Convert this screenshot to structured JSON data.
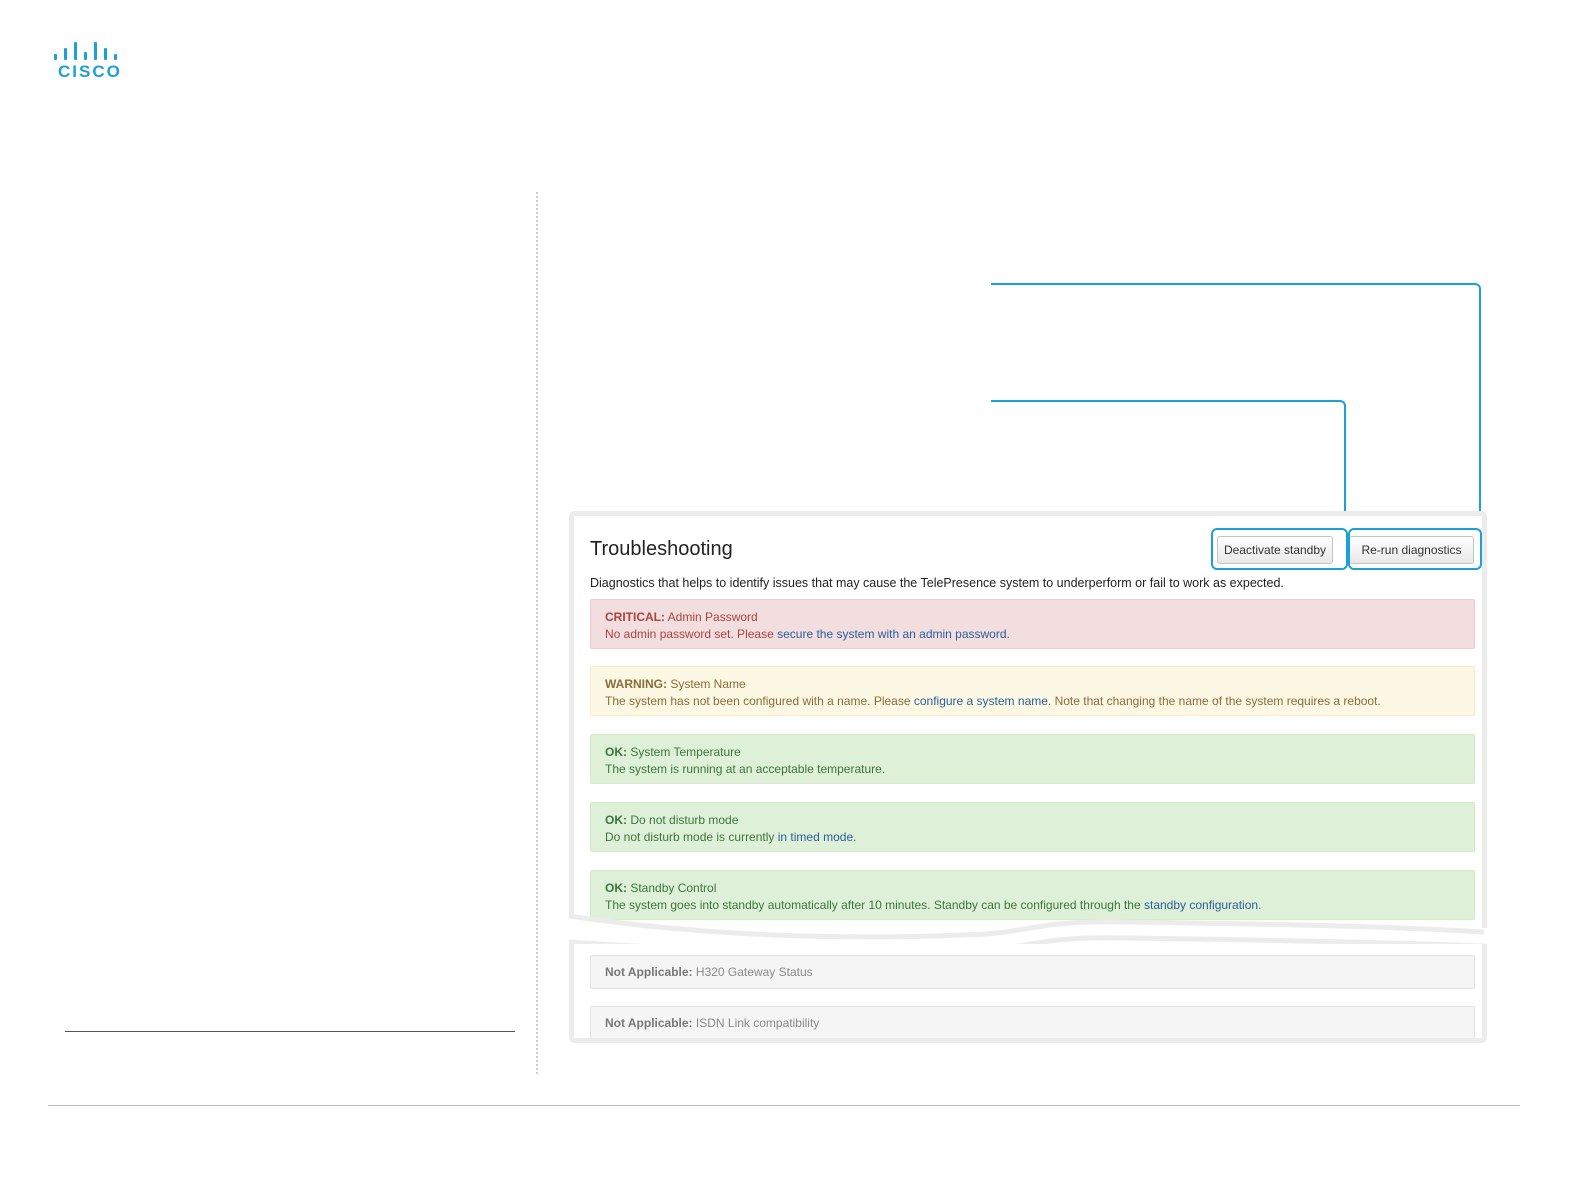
{
  "brand": {
    "logo_text": "CISCO",
    "accent": "#1ba0d7"
  },
  "panel": {
    "title": "Troubleshooting",
    "description": "Diagnostics that helps to identify issues that may cause the TelePresence system to underperform or fail to work as expected.",
    "buttons": {
      "deactivate_standby": "Deactivate standby",
      "rerun_diagnostics": "Re-run diagnostics"
    }
  },
  "diagnostics": [
    {
      "level": "CRITICAL:",
      "title": "Admin Password",
      "text_before": "No admin password set. Please ",
      "link": "secure the system with an admin password",
      "text_after": ".",
      "color": "#a94442"
    },
    {
      "level": "WARNING:",
      "title": "System Name",
      "text_before": "The system has not been configured with a name. Please ",
      "link": "configure a system name",
      "text_after": ". Note that changing the name of the system requires a reboot.",
      "color": "#8a6d3b"
    },
    {
      "level": "OK:",
      "title": "System Temperature",
      "text_before": "The system is running at an acceptable temperature.",
      "link": "",
      "text_after": "",
      "color": "#3c763d"
    },
    {
      "level": "OK:",
      "title": "Do not disturb mode",
      "text_before": "Do not disturb mode is currently ",
      "link": "in timed mode",
      "text_after": ".",
      "color": "#3c763d"
    },
    {
      "level": "OK:",
      "title": "Standby Control",
      "text_before": "The system goes into standby automatically after 10 minutes. Standby can be configured through the ",
      "link": "standby configuration",
      "text_after": ".",
      "color": "#3c763d"
    }
  ],
  "not_applicable": [
    {
      "level": "Not Applicable:",
      "title": "H320 Gateway Status"
    },
    {
      "level": "Not Applicable:",
      "title": "ISDN Link compatibility"
    }
  ]
}
